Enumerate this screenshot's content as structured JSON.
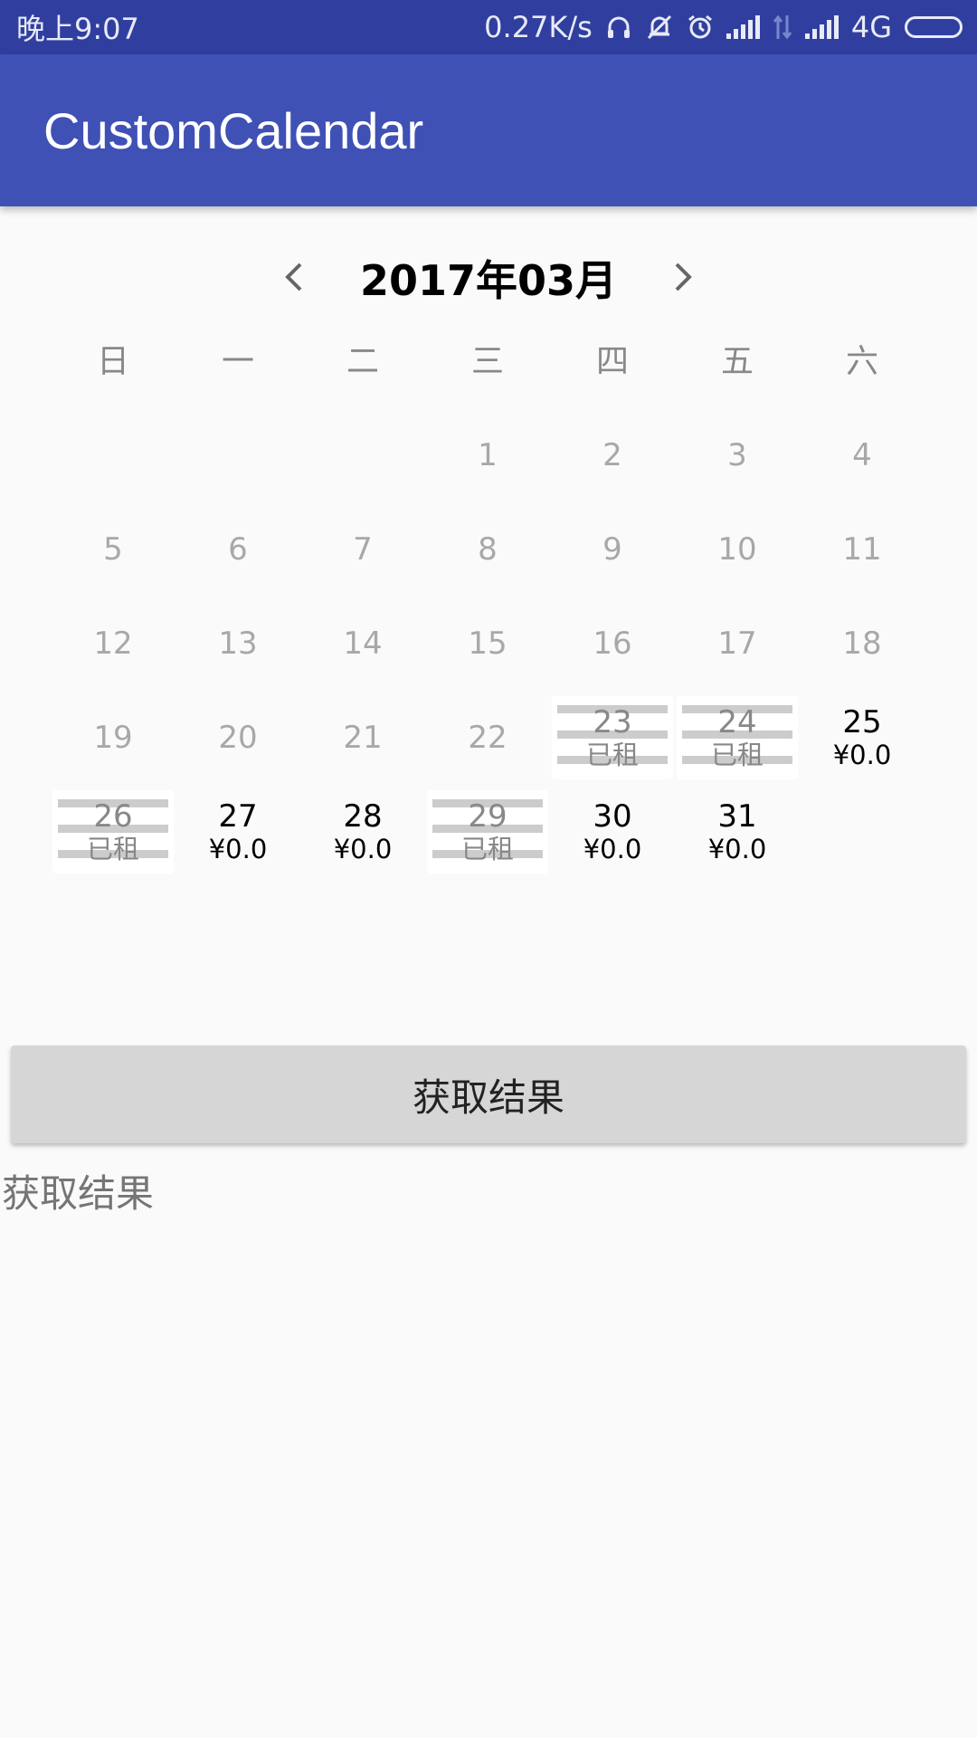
{
  "status_bar": {
    "time": "晚上9:07",
    "speed": "0.27K/s",
    "network": "4G"
  },
  "app_bar": {
    "title": "CustomCalendar"
  },
  "calendar": {
    "month_title": "2017年03月",
    "weekdays": [
      "日",
      "一",
      "二",
      "三",
      "四",
      "五",
      "六"
    ],
    "days": [
      {
        "n": "",
        "s": "",
        "state": "empty"
      },
      {
        "n": "",
        "s": "",
        "state": "empty"
      },
      {
        "n": "",
        "s": "",
        "state": "empty"
      },
      {
        "n": "1",
        "s": "",
        "state": "past"
      },
      {
        "n": "2",
        "s": "",
        "state": "past"
      },
      {
        "n": "3",
        "s": "",
        "state": "past"
      },
      {
        "n": "4",
        "s": "",
        "state": "past"
      },
      {
        "n": "5",
        "s": "",
        "state": "past"
      },
      {
        "n": "6",
        "s": "",
        "state": "past"
      },
      {
        "n": "7",
        "s": "",
        "state": "past"
      },
      {
        "n": "8",
        "s": "",
        "state": "past"
      },
      {
        "n": "9",
        "s": "",
        "state": "past"
      },
      {
        "n": "10",
        "s": "",
        "state": "past"
      },
      {
        "n": "11",
        "s": "",
        "state": "past"
      },
      {
        "n": "12",
        "s": "",
        "state": "past"
      },
      {
        "n": "13",
        "s": "",
        "state": "past"
      },
      {
        "n": "14",
        "s": "",
        "state": "past"
      },
      {
        "n": "15",
        "s": "",
        "state": "past"
      },
      {
        "n": "16",
        "s": "",
        "state": "past"
      },
      {
        "n": "17",
        "s": "",
        "state": "past"
      },
      {
        "n": "18",
        "s": "",
        "state": "past"
      },
      {
        "n": "19",
        "s": "",
        "state": "past"
      },
      {
        "n": "20",
        "s": "",
        "state": "past"
      },
      {
        "n": "21",
        "s": "",
        "state": "past"
      },
      {
        "n": "22",
        "s": "",
        "state": "past"
      },
      {
        "n": "23",
        "s": "已租",
        "state": "rented"
      },
      {
        "n": "24",
        "s": "已租",
        "state": "rented"
      },
      {
        "n": "25",
        "s": "¥0.0",
        "state": "avail"
      },
      {
        "n": "26",
        "s": "已租",
        "state": "rented"
      },
      {
        "n": "27",
        "s": "¥0.0",
        "state": "avail"
      },
      {
        "n": "28",
        "s": "¥0.0",
        "state": "avail"
      },
      {
        "n": "29",
        "s": "已租",
        "state": "rented"
      },
      {
        "n": "30",
        "s": "¥0.0",
        "state": "avail"
      },
      {
        "n": "31",
        "s": "¥0.0",
        "state": "avail"
      }
    ]
  },
  "button": {
    "label": "获取结果"
  },
  "result": {
    "text": "获取结果"
  },
  "icons": {
    "prev": "chevron-left-icon",
    "next": "chevron-right-icon"
  }
}
